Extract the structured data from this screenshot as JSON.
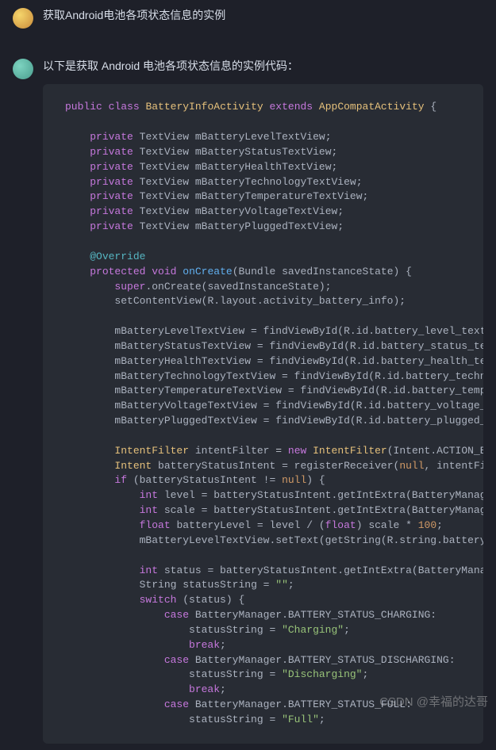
{
  "user_message": "获取Android电池各项状态信息的实例",
  "assistant_intro": "以下是获取 Android 电池各项状态信息的实例代码：",
  "watermark": "CSDN @幸福的达哥",
  "code": {
    "kw_public": "public",
    "kw_class": "class",
    "class_name": "BatteryInfoActivity",
    "kw_extends": "extends",
    "extends_class": "AppCompatActivity",
    "kw_private": "private",
    "type_textview": "TextView",
    "field1": "mBatteryLevelTextView",
    "field2": "mBatteryStatusTextView",
    "field3": "mBatteryHealthTextView",
    "field4": "mBatteryTechnologyTextView",
    "field5": "mBatteryTemperatureTextView",
    "field6": "mBatteryVoltageTextView",
    "field7": "mBatteryPluggedTextView",
    "annotation_override": "@Override",
    "kw_protected": "protected",
    "kw_void": "void",
    "method_oncreate": "onCreate",
    "param_bundle": "(Bundle savedInstanceState)",
    "kw_super": "super",
    "super_call": ".onCreate(savedInstanceState);",
    "setcontent": "setContentView(R.layout.activity_battery_info);",
    "fv1": "mBatteryLevelTextView = findViewById(R.id.battery_level_text_vie",
    "fv2": "mBatteryStatusTextView = findViewById(R.id.battery_status_text_v",
    "fv3": "mBatteryHealthTextView = findViewById(R.id.battery_health_text_v",
    "fv4": "mBatteryTechnologyTextView = findViewById(R.id.battery_technolog",
    "fv5": "mBatteryTemperatureTextView = findViewById(R.id.battery_temperat",
    "fv6": "mBatteryVoltageTextView = findViewById(R.id.battery_voltage_text",
    "fv7": "mBatteryPluggedTextView = findViewById(R.id.battery_plugged_text",
    "type_intentfilter": "IntentFilter",
    "var_intentfilter": "intentFilter",
    "kw_new": "new",
    "intentfilter_ctor": "(Intent.ACTION_BATTE",
    "type_intent": "Intent",
    "var_batterystatus": "batteryStatusIntent",
    "register_call": " = registerReceiver(",
    "kw_null": "null",
    "register_tail": ", intentFilter",
    "kw_if": "if",
    "if_cond": " (batteryStatusIntent != ",
    "if_tail": ") {",
    "kw_int": "int",
    "var_level": "level",
    "level_call": " = batteryStatusIntent.getIntExtra(BatteryManager.E",
    "var_scale": "scale",
    "scale_call": " = batteryStatusIntent.getIntExtra(BatteryManager.E",
    "kw_float": "float",
    "var_batterylevel": "batteryLevel",
    "bl_calc": " = level / (",
    "bl_calc2": ") scale * ",
    "num_100": "100",
    "semi": ";",
    "settext_call": "mBatteryLevelTextView.setText(getString(R.string.battery_lev",
    "var_status": "status",
    "status_call": " = batteryStatusIntent.getIntExtra(BatteryManager.",
    "type_string": "String",
    "var_statusstring": "statusString",
    "eq": " = ",
    "str_empty": "\"\"",
    "kw_switch": "switch",
    "switch_cond": " (status) {",
    "kw_case": "case",
    "case1": " BatteryManager.BATTERY_STATUS_CHARGING:",
    "assign_ss": "statusString = ",
    "str_charging": "\"Charging\"",
    "kw_break": "break",
    "case2": " BatteryManager.BATTERY_STATUS_DISCHARGING:",
    "str_discharging": "\"Discharging\"",
    "case3": " BatteryManager.BATTERY_STATUS_FULL:",
    "str_full": "\"Full\""
  }
}
